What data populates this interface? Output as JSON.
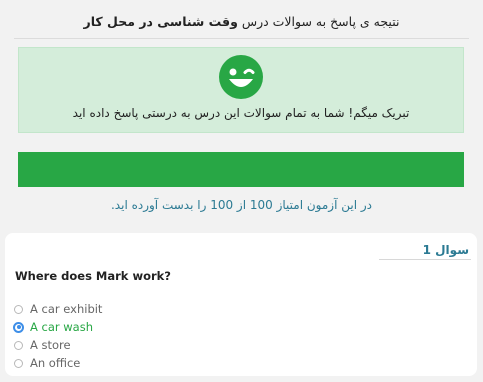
{
  "header": {
    "title_prefix": "نتیجه ی پاسخ به سوالات درس",
    "title_lesson": "وقت شناسی در محل کار"
  },
  "result": {
    "icon": "winking-smiley-icon",
    "message": "تبریک میگم! شما به تمام سوالات این درس به درستی پاسخ داده اید",
    "progress_fraction": 1.0,
    "score_text": "در این آزمون امتیاز 100 از 100 را بدست آورده اید."
  },
  "question": {
    "number_label": "سوال 1",
    "text": "Where does Mark work?",
    "options": [
      {
        "label": "A car exhibit",
        "selected": false
      },
      {
        "label": "A car wash",
        "selected": true
      },
      {
        "label": "A store",
        "selected": false
      },
      {
        "label": "An office",
        "selected": false
      }
    ]
  },
  "colors": {
    "success": "#28a745",
    "success_bg": "#d4edda",
    "accent_text": "#2b7a93",
    "radio_selected": "#3d8ee8"
  }
}
